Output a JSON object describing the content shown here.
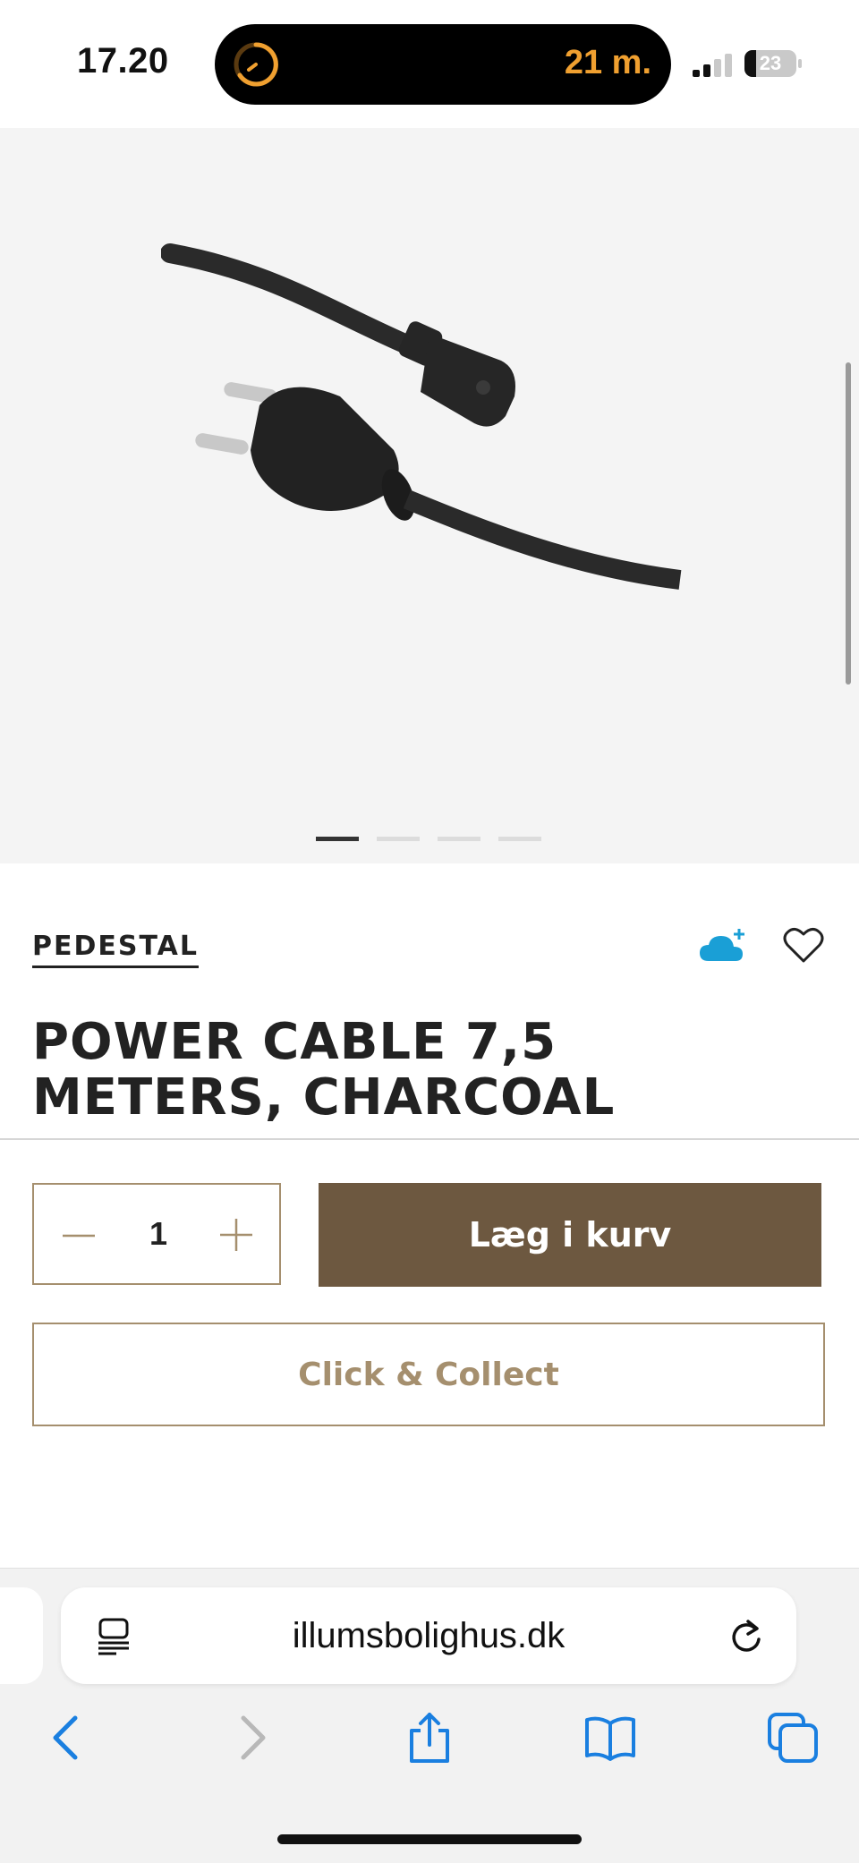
{
  "status_bar": {
    "time": "17.20",
    "activity_text": "21 m.",
    "battery": "23",
    "battery_level": 0.23
  },
  "gallery": {
    "image_alt": "Power cable charcoal",
    "slide_count": 4,
    "active_slide": 1
  },
  "product": {
    "brand": "PEDESTAL",
    "title": "POWER CABLE 7,5 METERS, CHARCOAL"
  },
  "purchase": {
    "quantity": "1",
    "add_to_cart_label": "Læg i kurv",
    "click_collect_label": "Click & Collect"
  },
  "browser": {
    "url": "illumsbolighus.dk"
  },
  "colors": {
    "accent_brown": "#6d5840",
    "border_tan": "#a58f6e",
    "link_blue": "#1a7fe0",
    "cloud_blue": "#1a9fd6",
    "activity_orange": "#f0a030"
  },
  "icons": {
    "timer": "timer-icon",
    "signal": "signal-icon",
    "cloud": "cloud-add-icon",
    "heart": "heart-icon",
    "minus": "minus-icon",
    "plus": "plus-icon",
    "reader": "reader-mode-icon",
    "reload": "reload-icon",
    "back": "chevron-left-icon",
    "forward": "chevron-right-icon",
    "share": "share-icon",
    "bookmarks": "book-icon",
    "tabs": "tabs-icon"
  }
}
